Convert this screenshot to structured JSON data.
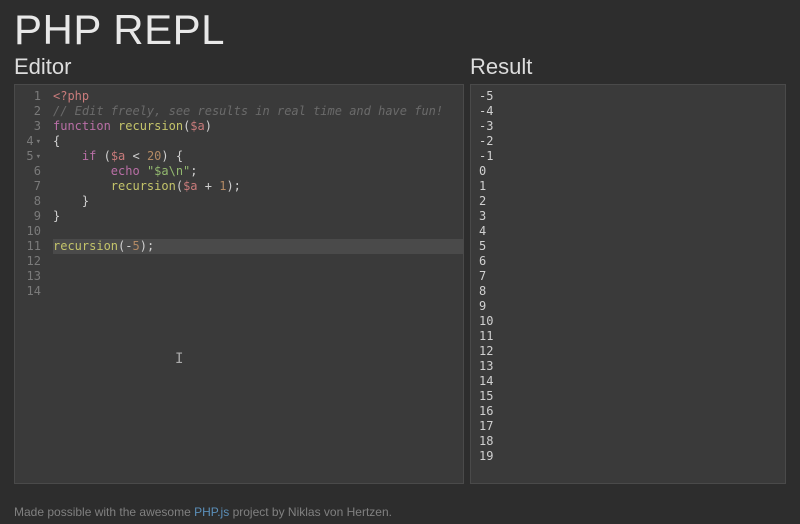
{
  "app": {
    "title": "PHP REPL"
  },
  "editor": {
    "title": "Editor",
    "line_numbers": [
      "1",
      "2",
      "3",
      "4",
      "5",
      "6",
      "7",
      "8",
      "9",
      "10",
      "11",
      "12",
      "13",
      "14"
    ],
    "fold_rows": [
      4,
      5
    ],
    "highlighted_line": 11,
    "code_tokens": [
      [
        [
          "tag",
          "<?php"
        ]
      ],
      [
        [
          "cmt",
          "// Edit freely, see results in real time and have fun!"
        ]
      ],
      [
        [
          "kw",
          "function"
        ],
        [
          "punc",
          " "
        ],
        [
          "fn",
          "recursion"
        ],
        [
          "punc",
          "("
        ],
        [
          "var",
          "$a"
        ],
        [
          "punc",
          ")"
        ]
      ],
      [
        [
          "punc",
          "{"
        ]
      ],
      [
        [
          "punc",
          "    "
        ],
        [
          "kw",
          "if"
        ],
        [
          "punc",
          " ("
        ],
        [
          "var",
          "$a"
        ],
        [
          "punc",
          " < "
        ],
        [
          "num",
          "20"
        ],
        [
          "punc",
          ") {"
        ]
      ],
      [
        [
          "punc",
          "        "
        ],
        [
          "kw",
          "echo"
        ],
        [
          "punc",
          " "
        ],
        [
          "str",
          "\"$a\\n\""
        ],
        [
          "punc",
          ";"
        ]
      ],
      [
        [
          "punc",
          "        "
        ],
        [
          "fn",
          "recursion"
        ],
        [
          "punc",
          "("
        ],
        [
          "var",
          "$a"
        ],
        [
          "punc",
          " + "
        ],
        [
          "num",
          "1"
        ],
        [
          "punc",
          ");"
        ]
      ],
      [
        [
          "punc",
          "    }"
        ]
      ],
      [
        [
          "punc",
          "}"
        ]
      ],
      [],
      [
        [
          "fn",
          "recursion"
        ],
        [
          "punc",
          "(-"
        ],
        [
          "num",
          "5"
        ],
        [
          "punc",
          ");"
        ]
      ],
      [],
      [],
      []
    ]
  },
  "result": {
    "title": "Result",
    "output": [
      "-5",
      "-4",
      "-3",
      "-2",
      "-1",
      "0",
      "1",
      "2",
      "3",
      "4",
      "5",
      "6",
      "7",
      "8",
      "9",
      "10",
      "11",
      "12",
      "13",
      "14",
      "15",
      "16",
      "17",
      "18",
      "19"
    ]
  },
  "footer": {
    "prefix": "Made possible with the awesome ",
    "link_text": "PHP.js",
    "suffix": " project by Niklas von Hertzen."
  }
}
